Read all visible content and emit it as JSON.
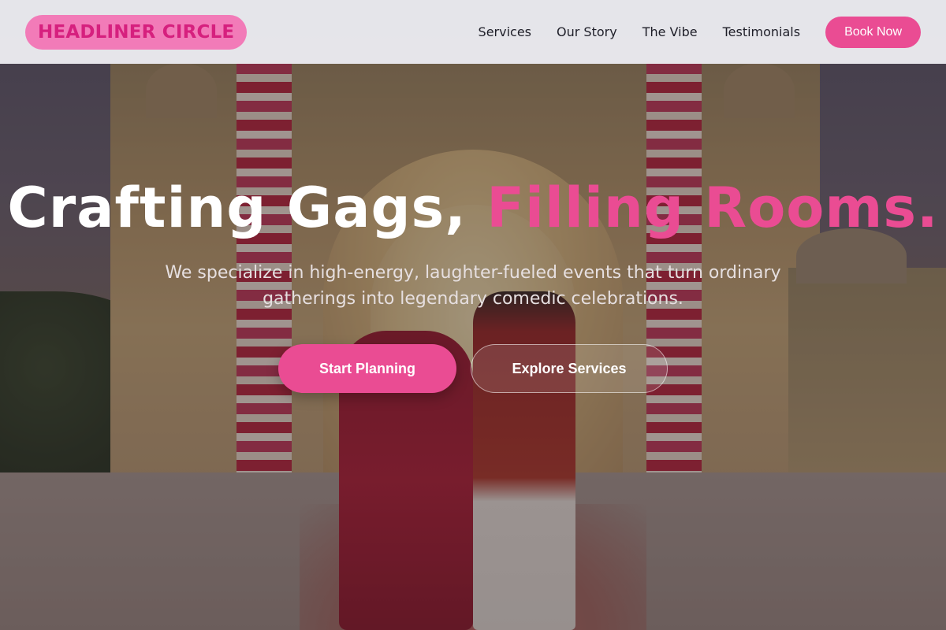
{
  "brand": {
    "logo_text": "HEADLINER CIRCLE"
  },
  "nav": {
    "links": [
      "Services",
      "Our Story",
      "The Vibe",
      "Testimonials"
    ],
    "cta_label": "Book Now"
  },
  "hero": {
    "headline_part1": "Crafting Gags,",
    "headline_accent": "Filling Rooms.",
    "subtitle": "We specialize in high-energy, laughter-fueled events that turn ordinary gatherings into legendary comedic celebrations.",
    "primary_cta": "Start Planning",
    "secondary_cta": "Explore Services"
  },
  "colors": {
    "accent": "#ea4c93",
    "logo_bg": "#f27bb8",
    "header_bg": "#ececf0"
  }
}
